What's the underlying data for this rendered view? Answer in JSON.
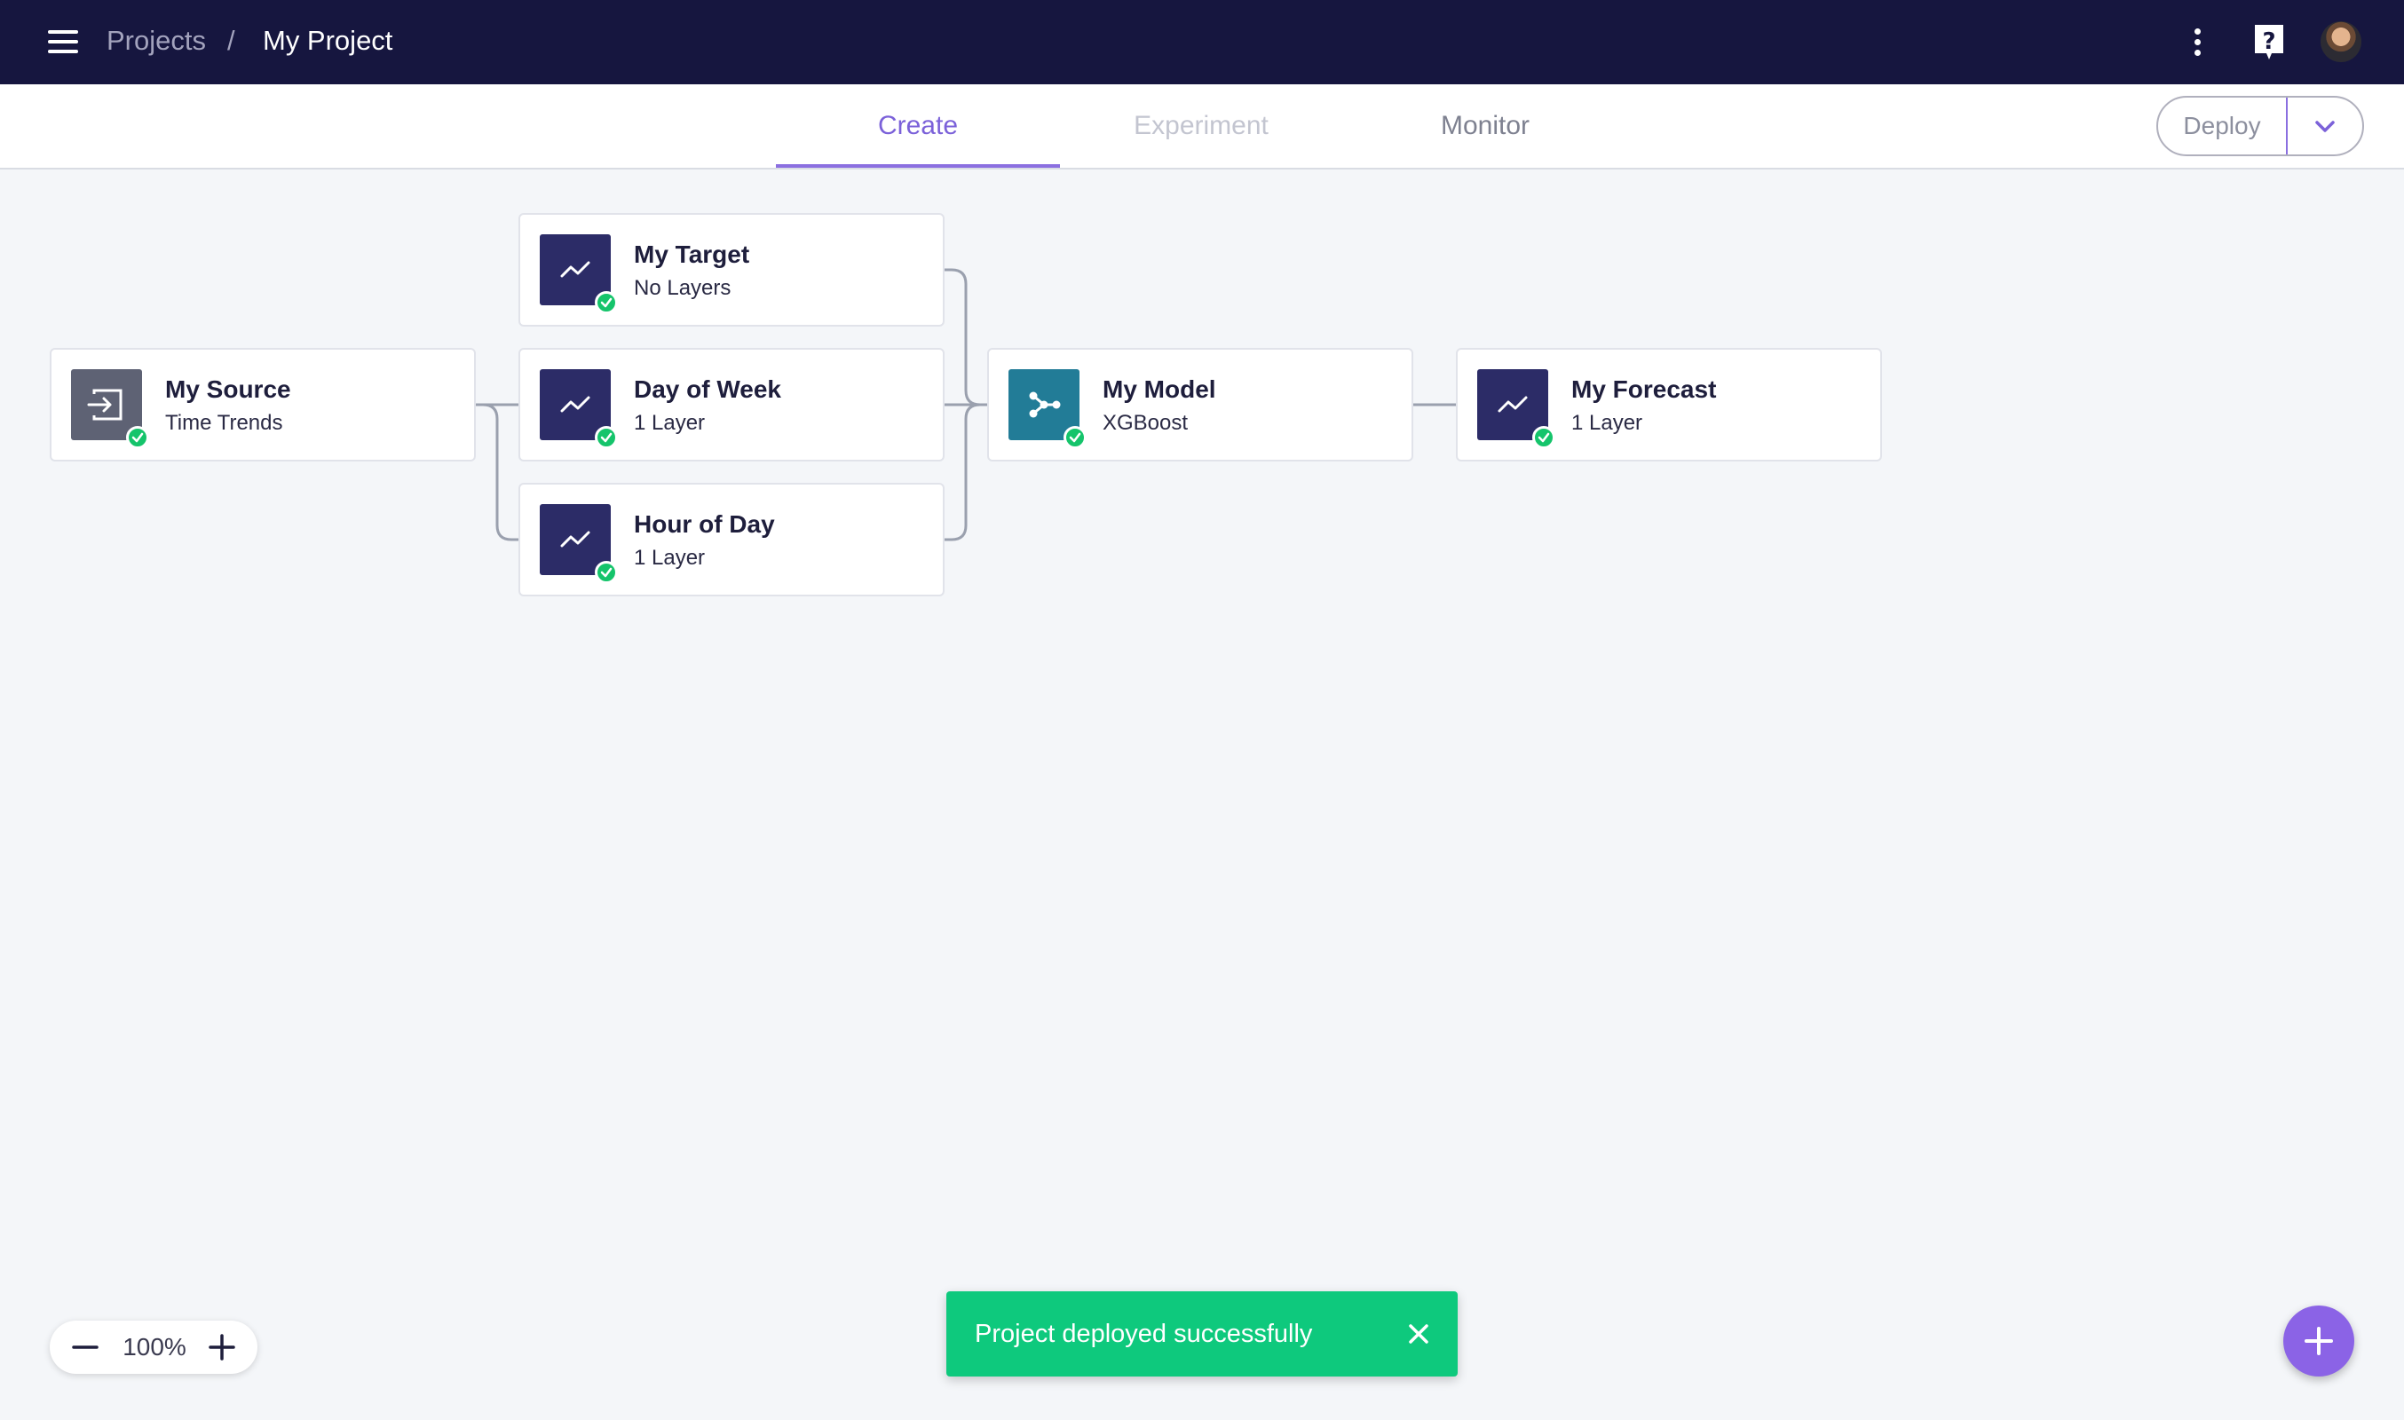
{
  "header": {
    "breadcrumb_root": "Projects",
    "breadcrumb_separator": "/",
    "project_name": "My Project",
    "icons": [
      "menu-icon",
      "more-vertical-icon",
      "help-icon",
      "user-avatar"
    ]
  },
  "tabs": [
    {
      "label": "Create",
      "state": "active"
    },
    {
      "label": "Experiment",
      "state": "disabled"
    },
    {
      "label": "Monitor",
      "state": "inactive"
    }
  ],
  "deploy": {
    "label": "Deploy",
    "menu_icon": "chevron-down-icon"
  },
  "nodes": {
    "source": {
      "title": "My Source",
      "subtitle": "Time Trends",
      "icon": "input-icon",
      "status": "success"
    },
    "target": {
      "title": "My Target",
      "subtitle": "No Layers",
      "icon": "trend-icon",
      "status": "success"
    },
    "day_of_week": {
      "title": "Day of Week",
      "subtitle": "1 Layer",
      "icon": "trend-icon",
      "status": "success"
    },
    "hour_of_day": {
      "title": "Hour of Day",
      "subtitle": "1 Layer",
      "icon": "trend-icon",
      "status": "success"
    },
    "model": {
      "title": "My Model",
      "subtitle": "XGBoost",
      "icon": "model-graph-icon",
      "status": "success"
    },
    "forecast": {
      "title": "My Forecast",
      "subtitle": "1 Layer",
      "icon": "trend-icon",
      "status": "success"
    }
  },
  "zoom": {
    "value": "100%"
  },
  "toast": {
    "message": "Project deployed successfully"
  },
  "colors": {
    "topbar": "#16163f",
    "accent": "#8b6fe0",
    "success": "#0ec97d",
    "trend_icon_bg": "#2c2c67",
    "source_icon_bg": "#5e6274",
    "model_icon_bg": "#227c97",
    "fab": "#8b63e6"
  }
}
